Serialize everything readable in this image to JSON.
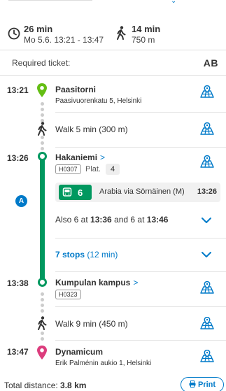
{
  "summary": {
    "duration": "26 min",
    "date_range": "Mo 5.6. 13:21 - 13:47",
    "walk_duration": "14 min",
    "walk_distance": "750 m"
  },
  "ticket": {
    "label": "Required ticket:",
    "zone": "AB"
  },
  "legs": {
    "origin": {
      "time": "13:21",
      "name": "Paasitorni",
      "address": "Paasivuorenkatu 5, Helsinki"
    },
    "walk1": {
      "text": "Walk 5 min (300 m)"
    },
    "board": {
      "time": "13:26",
      "name": "Hakaniemi",
      "code": "H0307",
      "platform_label": "Plat.",
      "platform": "4"
    },
    "tram": {
      "line": "6",
      "destination": "Arabia via Sörnäinen (M)",
      "departure": "13:26"
    },
    "also": {
      "prefix": "Also 6 at ",
      "time1": "13:36",
      "middle": " and 6 at ",
      "time2": "13:46"
    },
    "stops": {
      "count": "7 stops",
      "duration": "(12 min)"
    },
    "alight": {
      "time": "13:38",
      "name": "Kumpulan kampus",
      "code": "H0323"
    },
    "walk2": {
      "text": "Walk 9 min (450 m)"
    },
    "destination": {
      "time": "13:47",
      "name": "Dynamicum",
      "address": "Erik Palménin aukio 1, Helsinki"
    }
  },
  "zone_marker": "A",
  "footer": {
    "total_label": "Total distance: ",
    "total_value": "3.8 km",
    "print_label": "Print"
  },
  "colors": {
    "tram": "#00985f",
    "accent": "#007ac9",
    "origin": "#64be14",
    "destination": "#dc3d7d"
  },
  "icons": [
    "clock-icon",
    "walk-icon",
    "location-pin-icon",
    "map-icon",
    "tram-icon",
    "chevron-down-icon",
    "chevron-right-icon",
    "print-icon"
  ]
}
